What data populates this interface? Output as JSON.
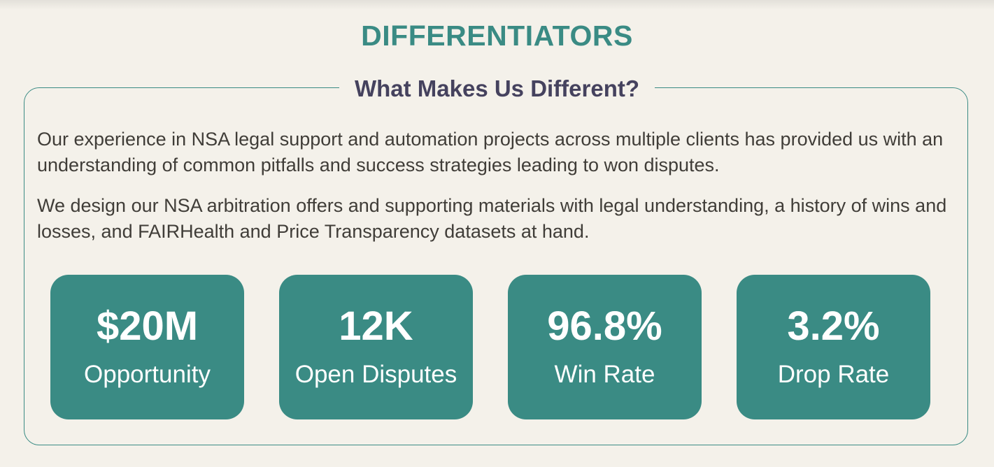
{
  "colors": {
    "background": "#f4f1ea",
    "accent": "#3a8b84",
    "card": "#3a8b84",
    "heading": "#3a8b84",
    "subheading": "#45425e",
    "body_text": "#403d38"
  },
  "section": {
    "title": "DIFFERENTIATORS"
  },
  "panel": {
    "title": "What Makes Us Different?",
    "paragraphs": [
      "Our experience in NSA legal support and automation projects across multiple clients has provided us with an understanding of common pitfalls and success strategies leading to won disputes.",
      "We design our NSA arbitration offers and supporting materials with legal understanding, a history of wins and losses, and FAIRHealth and Price Transparency datasets at hand."
    ]
  },
  "stats": [
    {
      "value": "$20M",
      "label": "Opportunity"
    },
    {
      "value": "12K",
      "label": "Open Disputes"
    },
    {
      "value": "96.8%",
      "label": "Win Rate"
    },
    {
      "value": "3.2%",
      "label": "Drop Rate"
    }
  ]
}
